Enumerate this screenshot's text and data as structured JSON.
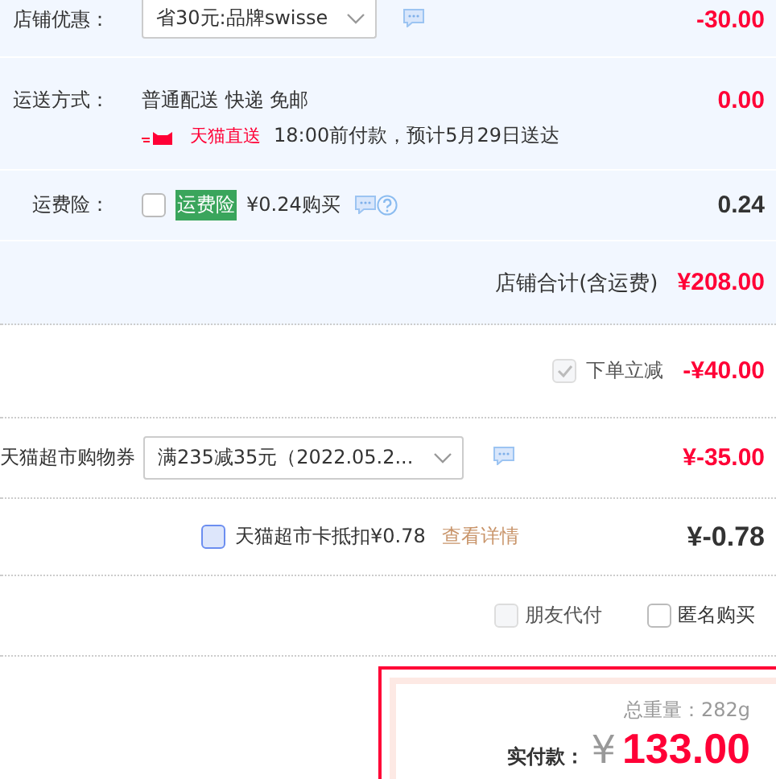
{
  "store_discount": {
    "label": "店铺优惠：",
    "select": "省30元:品牌swisse",
    "amount": "-30.00"
  },
  "shipping": {
    "label": "运送方式：",
    "method": "普通配送 快递 免邮",
    "badge": "天猫直送",
    "eta": "18:00前付款，预计5月29日送达",
    "amount": "0.00"
  },
  "insurance": {
    "label": "运费险：",
    "checked": false,
    "tag": "运费险",
    "price": "¥0.24购买",
    "amount": "0.24"
  },
  "store_total": {
    "label": "店铺合计(含运费)",
    "amount": "¥208.00"
  },
  "order_discount": {
    "checked": true,
    "disabled": true,
    "label": "下单立减",
    "amount": "-¥40.00"
  },
  "coupon": {
    "label": "天猫超市购物券",
    "select": "满235减35元（2022.05.2...",
    "amount": "¥-35.00"
  },
  "card": {
    "checked": false,
    "label": "天猫超市卡抵扣¥0.78",
    "link": "查看详情",
    "amount": "¥-0.78"
  },
  "options": [
    {
      "label": "朋友代付",
      "checked": false,
      "disabled": true
    },
    {
      "label": "匿名购买",
      "checked": false,
      "disabled": false
    }
  ],
  "payment": {
    "weight_label": "总重量：",
    "weight": "282g",
    "total_label": "实付款：",
    "currency": "¥",
    "total": "133.00"
  }
}
